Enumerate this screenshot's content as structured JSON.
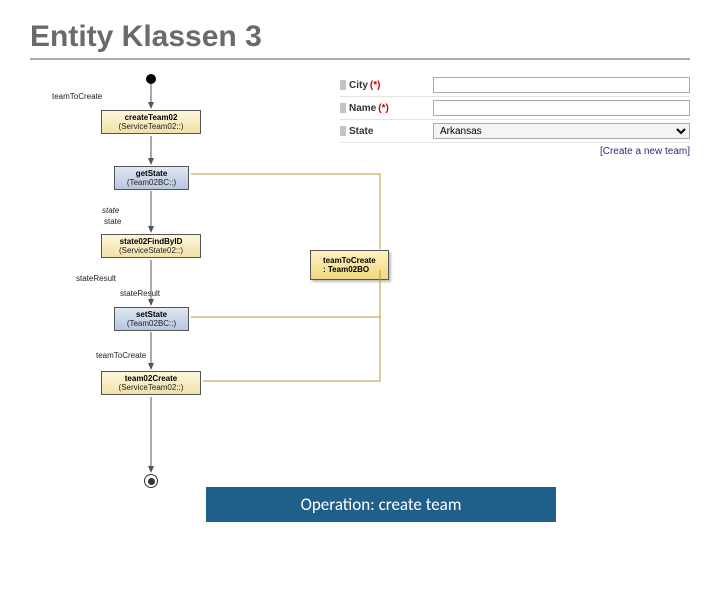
{
  "title": "Entity Klassen 3",
  "form": {
    "rows": [
      {
        "label": "City",
        "required": true,
        "value": ""
      },
      {
        "label": "Name",
        "required": true,
        "value": ""
      },
      {
        "label": "State",
        "required": false,
        "value": "Arkansas",
        "select": true
      }
    ],
    "action": "[Create a new team]"
  },
  "diagram": {
    "topLabel": "teamToCreate",
    "nodes": {
      "n1": {
        "name": "createTeam02",
        "sub": "(ServiceTeam02::)"
      },
      "n2": {
        "name": "getState",
        "sub": "(Team02BC::)"
      },
      "n3": {
        "name": "state02FindByID",
        "sub": "(ServiceState02::)"
      },
      "n4": {
        "name": "setState",
        "sub": "(Team02BC::)"
      },
      "n5": {
        "name": "team02Create",
        "sub": "(ServiceTeam02::)"
      }
    },
    "labels": {
      "l1": "state",
      "l2": "state",
      "l3": "stateResult",
      "l4": "stateResult",
      "l5": "teamToCreate"
    },
    "data": "teamToCreate : Team02BO"
  },
  "caption": "Operation: create team"
}
